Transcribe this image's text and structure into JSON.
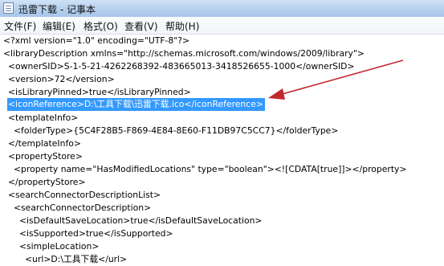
{
  "window": {
    "title": "迅雷下载 - 记事本",
    "app_icon": "notepad-icon"
  },
  "menu": {
    "items": [
      {
        "label": "文件(F)"
      },
      {
        "label": "编辑(E)"
      },
      {
        "label": "格式(O)"
      },
      {
        "label": "查看(V)"
      },
      {
        "label": "帮助(H)"
      }
    ]
  },
  "editor": {
    "selected_line_index": 6,
    "lines": [
      "<?xml version=\"1.0\" encoding=\"UTF-8\"?>",
      "<libraryDescription xmlns=\"http://schemas.microsoft.com/windows/2009/library\">",
      "<ownerSID>S-1-5-21-4262268392-483665013-3418526655-1000</ownerSID>",
      "<version>72</version>",
      "<isLibraryPinned>true</isLibraryPinned>",
      "<iconReference>D:\\工具下载\\迅雷下载.ico</iconReference>",
      "<templateInfo>",
      "<folderType>{5C4F28B5-F869-4E84-8E60-F11DB97C5CC7}</folderType>",
      "</templateInfo>",
      "<propertyStore>",
      "<property name=\"HasModifiedLocations\" type=\"boolean\"><![CDATA[true]]></property>",
      "</propertyStore>",
      "<searchConnectorDescriptionList>",
      "<searchConnectorDescription>",
      "<isDefaultSaveLocation>true</isDefaultSaveLocation>",
      "<isSupported>true</isSupported>",
      "<simpleLocation>",
      "<url>D:\\工具下载</url>"
    ]
  },
  "annotation": {
    "arrow_color": "#c0282d"
  }
}
